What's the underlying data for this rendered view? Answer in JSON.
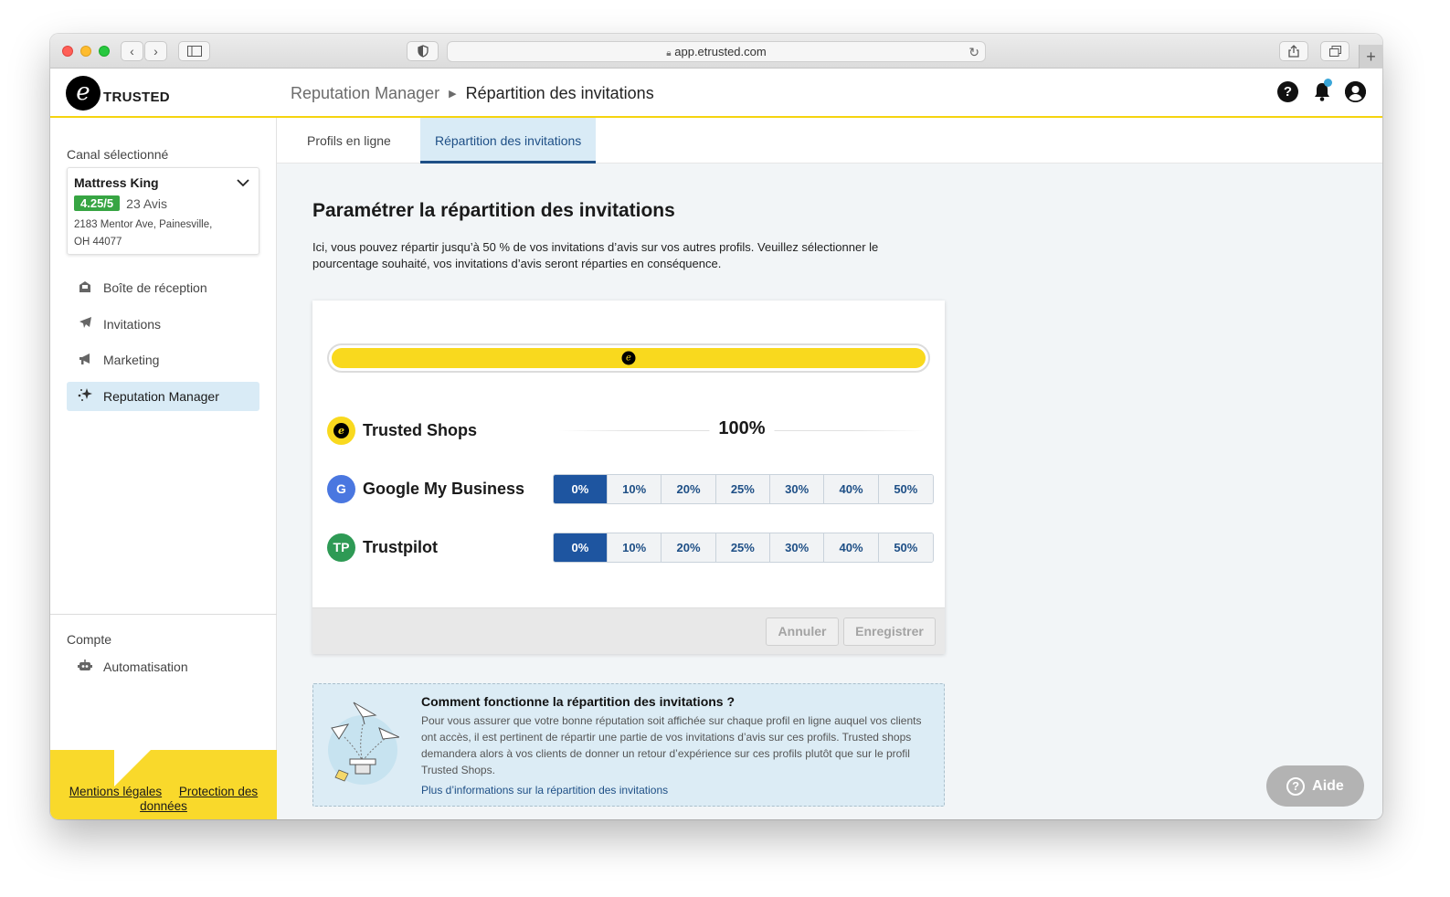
{
  "browser": {
    "url": "app.etrusted.com"
  },
  "header": {
    "logo_text": "TRUSTED",
    "breadcrumb_parent": "Reputation Manager",
    "breadcrumb_current": "Répartition des invitations",
    "icons": [
      "help-icon",
      "bell-icon",
      "account-icon"
    ]
  },
  "sidebar": {
    "channel_label": "Canal sélectionné",
    "channel": {
      "name": "Mattress King",
      "rating": "4.25/5",
      "reviews": "23 Avis",
      "address_line1": "2183 Mentor Ave, Painesville,",
      "address_line2": "OH 44077"
    },
    "items": [
      {
        "label": "Boîte de réception",
        "icon": "inbox-icon"
      },
      {
        "label": "Invitations",
        "icon": "paper-plane-icon"
      },
      {
        "label": "Marketing",
        "icon": "megaphone-icon"
      },
      {
        "label": "Reputation Manager",
        "icon": "sparkles-icon",
        "active": true
      }
    ],
    "account_label": "Compte",
    "account_items": [
      {
        "label": "Automatisation",
        "icon": "robot-icon"
      }
    ],
    "footer": {
      "legal": "Mentions légales",
      "privacy_line1": "Protection des",
      "privacy_line2": "données"
    }
  },
  "tabs": [
    {
      "label": "Profils en ligne"
    },
    {
      "label": "Répartition des invitations",
      "active": true
    }
  ],
  "main": {
    "title": "Paramétrer la répartition des invitations",
    "description": "Ici, vous pouvez répartir jusqu’à 50 % de vos invitations d’avis sur vos autres profils. Veuillez sélectionner le pourcentage souhaité, vos invitations d’avis seront réparties en conséquence.",
    "distribution_bar": {
      "trusted_shops_share": 1.0
    },
    "profiles": [
      {
        "name": "Trusted Shops",
        "icon_letters": "e",
        "value": "100%"
      },
      {
        "name": "Google My Business",
        "icon_letters": "G",
        "selected": "0%"
      },
      {
        "name": "Trustpilot",
        "icon_letters": "TP",
        "selected": "0%"
      }
    ],
    "options": [
      "0%",
      "10%",
      "20%",
      "25%",
      "30%",
      "40%",
      "50%"
    ],
    "cancel_label": "Annuler",
    "save_label": "Enregistrer",
    "info": {
      "title": "Comment fonctionne la répartition des invitations ?",
      "text": "Pour vous assurer que votre bonne réputation soit affichée sur chaque profil en ligne auquel vos clients ont accès, il est pertinent de répartir une partie de vos invitations d’avis sur ces profils. Trusted shops demandera alors à vos clients de donner un retour d’expérience sur ces profils plutôt que sur le profil Trusted Shops.",
      "link": "Plus d’informations sur la répartition des invitations"
    },
    "help_button": "Aide"
  },
  "colors": {
    "brand_yellow": "#f9d91e",
    "primary_blue": "#1e55a0",
    "rating_green": "#37a543",
    "active_tab_bg": "#d9ebf6"
  }
}
